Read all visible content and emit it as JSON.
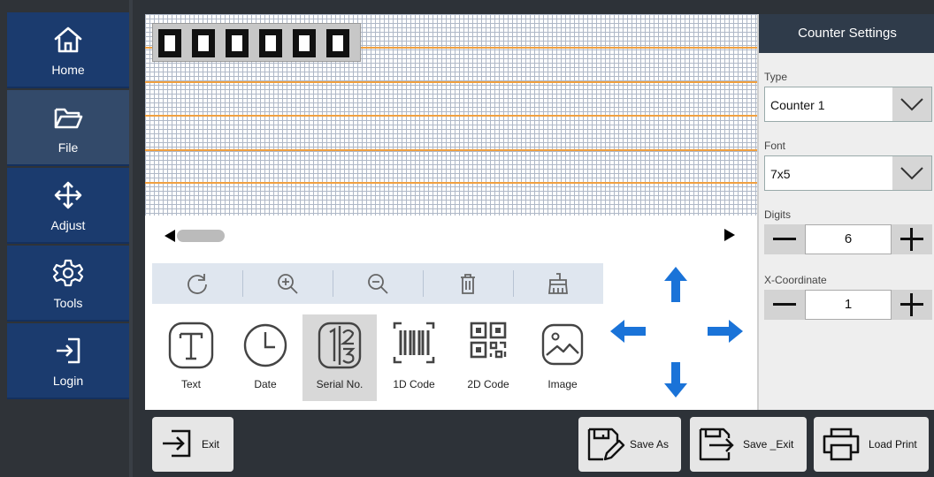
{
  "sidebar": {
    "items": [
      {
        "label": "Home",
        "icon": "home-icon"
      },
      {
        "label": "File",
        "icon": "folder-icon"
      },
      {
        "label": "Adjust",
        "icon": "move-icon"
      },
      {
        "label": "Tools",
        "icon": "gear-icon"
      },
      {
        "label": "Login",
        "icon": "login-icon"
      }
    ],
    "selected": "File"
  },
  "canvas": {
    "preview_digits": "000000"
  },
  "toolbar": {
    "buttons": [
      "redo-icon",
      "zoom-in-icon",
      "zoom-out-icon",
      "delete-icon",
      "clear-icon"
    ]
  },
  "elements": {
    "items": [
      {
        "label": "Text",
        "icon": "text-icon"
      },
      {
        "label": "Date",
        "icon": "clock-icon"
      },
      {
        "label": "Serial No.",
        "icon": "serial-number-icon"
      },
      {
        "label": "1D Code",
        "icon": "barcode-icon"
      },
      {
        "label": "2D Code",
        "icon": "qr-code-icon"
      },
      {
        "label": "Image",
        "icon": "image-icon"
      }
    ],
    "selected": "Serial No."
  },
  "settings": {
    "title": "Counter Settings",
    "type_label": "Type",
    "type_value": "Counter 1",
    "font_label": "Font",
    "font_value": "7x5",
    "digits_label": "Digits",
    "digits_value": "6",
    "xcoord_label": "X-Coordinate",
    "xcoord_value": "1"
  },
  "footer": {
    "exit": "Exit",
    "save_as": "Save As",
    "save_exit": "Save _Exit",
    "load_print": "Load Print"
  },
  "colors": {
    "sidebar": "#1b3b6e",
    "arrow_blue": "#1a73d8",
    "header_dark": "#2f3b4a"
  }
}
